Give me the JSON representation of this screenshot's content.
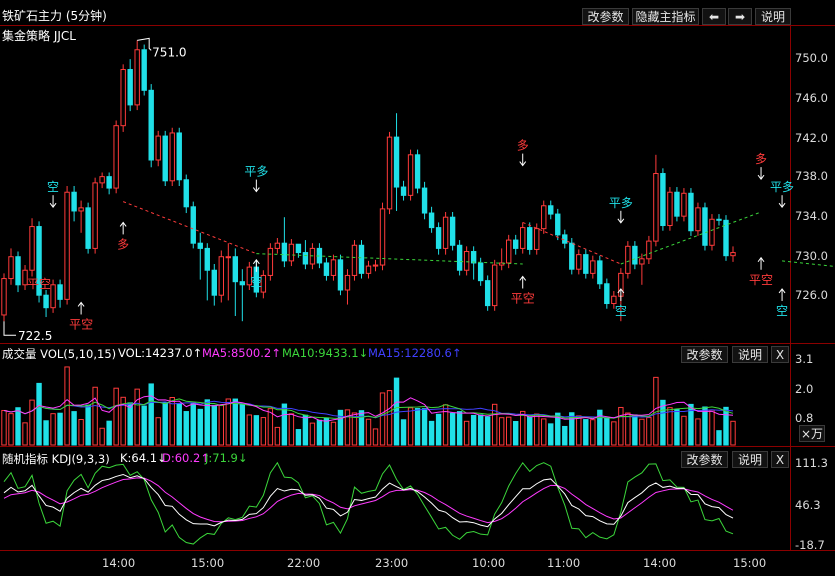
{
  "header": {
    "title": "铁矿石主力 (5分钟)",
    "strategy": "集金策略 JJCL",
    "buttons": {
      "edit_params": "改参数",
      "hide_indicators": "隐藏主指标",
      "prev": "⬅",
      "next": "➡",
      "help": "说明"
    }
  },
  "colors": {
    "up": "#ff3b3b",
    "down": "#20e0e8",
    "ma5": "#ff3bff",
    "ma10": "#3bd63b",
    "ma15": "#4040ff",
    "k": "#ffffff",
    "d": "#ff3bff",
    "j": "#3bd63b",
    "grid": "#8b0000"
  },
  "volume_panel": {
    "label": "成交量 VOL(5,10,15)",
    "vol": "VOL:14237.0↑",
    "ma5": "MA5:8500.2↑",
    "ma10": "MA10:9433.1↓",
    "ma15": "MA15:12280.6↑",
    "edit_button": "改参数",
    "help_button": "说明",
    "close_button": "X",
    "unit": "×万"
  },
  "kdj_panel": {
    "label": "随机指标 KDJ(9,3,3)",
    "k": "K:64.1↓",
    "d": "D:60.2↑",
    "j": "J:71.9↓",
    "edit_button": "改参数",
    "help_button": "说明",
    "close_button": "X"
  },
  "chart_data": [
    {
      "type": "candlestick",
      "title": "铁矿石主力 (5分钟)",
      "y_ticks": [
        "750.0",
        "746.0",
        "742.0",
        "738.0",
        "734.0",
        "730.0",
        "726.0"
      ],
      "ylim": [
        722,
        752
      ],
      "high_label": "751.0",
      "low_label": "722.5",
      "candles": [
        [
          724.6,
          728.1,
          724.0,
          728.6
        ],
        [
          728.1,
          730.2,
          727.5,
          731.0
        ],
        [
          730.2,
          727.5,
          726.8,
          730.7
        ],
        [
          727.5,
          728.9,
          727.0,
          729.4
        ],
        [
          728.9,
          733.1,
          728.3,
          733.9
        ],
        [
          733.1,
          726.5,
          725.8,
          733.6
        ],
        [
          726.5,
          725.3,
          724.4,
          727.0
        ],
        [
          725.3,
          727.5,
          724.8,
          728.0
        ],
        [
          727.5,
          726.1,
          725.3,
          728.0
        ],
        [
          726.1,
          736.4,
          725.6,
          737.0
        ],
        [
          736.4,
          734.6,
          733.6,
          737.0
        ],
        [
          734.6,
          734.9,
          732.5,
          735.6
        ],
        [
          734.9,
          731.0,
          730.5,
          735.4
        ],
        [
          731.0,
          737.3,
          730.5,
          737.8
        ],
        [
          737.3,
          737.9,
          736.8,
          738.3
        ],
        [
          737.9,
          736.8,
          736.2,
          738.3
        ],
        [
          736.8,
          742.8,
          736.3,
          743.3
        ],
        [
          742.8,
          748.2,
          742.2,
          748.7
        ],
        [
          748.2,
          744.8,
          744.2,
          749.2
        ],
        [
          744.8,
          750.1,
          744.3,
          751.0
        ],
        [
          750.1,
          746.2,
          745.7,
          750.6
        ],
        [
          746.2,
          739.5,
          738.8,
          746.8
        ],
        [
          739.5,
          741.8,
          738.9,
          742.3
        ],
        [
          741.8,
          737.5,
          737.0,
          742.3
        ],
        [
          737.5,
          742.1,
          737.0,
          742.6
        ],
        [
          742.1,
          737.6,
          737.0,
          742.6
        ],
        [
          737.6,
          735.0,
          734.4,
          738.1
        ],
        [
          735.0,
          731.5,
          731.0,
          735.5
        ],
        [
          731.5,
          731.0,
          728.0,
          732.5
        ],
        [
          731.0,
          728.9,
          726.0,
          731.5
        ],
        [
          728.9,
          726.5,
          725.5,
          729.5
        ],
        [
          726.5,
          730.2,
          725.8,
          730.8
        ],
        [
          730.2,
          730.2,
          726.0,
          731.5
        ],
        [
          730.2,
          727.8,
          724.5,
          731.0
        ],
        [
          727.8,
          727.5,
          724.0,
          729.0
        ],
        [
          727.5,
          729.2,
          727.0,
          729.7
        ],
        [
          729.2,
          726.8,
          726.3,
          729.9
        ],
        [
          726.8,
          728.4,
          726.2,
          728.9
        ],
        [
          728.4,
          731.0,
          727.9,
          731.5
        ],
        [
          731.0,
          731.5,
          730.5,
          732.0
        ],
        [
          731.5,
          729.8,
          729.2,
          734.0
        ],
        [
          729.8,
          731.4,
          729.3,
          731.9
        ],
        [
          731.4,
          730.6,
          730.1,
          731.1
        ],
        [
          730.6,
          729.5,
          729.0,
          731.8
        ],
        [
          729.5,
          731.0,
          729.0,
          731.5
        ],
        [
          731.0,
          729.6,
          729.1,
          731.5
        ],
        [
          729.6,
          728.4,
          727.9,
          730.1
        ],
        [
          728.4,
          729.9,
          727.9,
          730.4
        ],
        [
          729.9,
          727.0,
          726.5,
          730.4
        ],
        [
          727.0,
          728.4,
          725.6,
          729.0
        ],
        [
          728.4,
          731.3,
          727.9,
          731.8
        ],
        [
          731.3,
          728.6,
          728.1,
          731.8
        ],
        [
          728.6,
          729.3,
          728.1,
          729.8
        ],
        [
          729.3,
          729.4,
          728.8,
          729.9
        ],
        [
          729.4,
          734.8,
          728.9,
          735.4
        ],
        [
          734.8,
          741.7,
          734.3,
          742.2
        ],
        [
          741.7,
          736.9,
          734.6,
          744.0
        ],
        [
          736.9,
          736.1,
          735.6,
          737.5
        ],
        [
          736.1,
          740.0,
          735.6,
          740.5
        ],
        [
          740.0,
          736.8,
          736.3,
          740.5
        ],
        [
          736.8,
          734.4,
          733.8,
          737.4
        ],
        [
          734.4,
          733.0,
          732.5,
          735.0
        ],
        [
          733.0,
          731.0,
          730.4,
          733.5
        ],
        [
          731.0,
          734.0,
          730.4,
          734.5
        ],
        [
          734.0,
          731.3,
          730.8,
          734.5
        ],
        [
          731.3,
          728.9,
          728.4,
          731.8
        ],
        [
          728.9,
          730.7,
          728.4,
          731.2
        ],
        [
          730.7,
          729.6,
          728.0,
          731.2
        ],
        [
          729.6,
          727.9,
          727.4,
          730.1
        ],
        [
          727.9,
          725.5,
          725.0,
          728.4
        ],
        [
          725.5,
          729.4,
          725.0,
          729.9
        ],
        [
          729.4,
          729.6,
          728.9,
          731.0
        ],
        [
          729.6,
          731.8,
          729.1,
          732.3
        ],
        [
          731.8,
          731.0,
          730.4,
          732.3
        ],
        [
          731.0,
          733.0,
          730.5,
          733.5
        ],
        [
          733.0,
          730.9,
          730.4,
          733.5
        ],
        [
          730.9,
          732.9,
          730.4,
          733.4
        ],
        [
          732.9,
          735.1,
          732.4,
          735.6
        ],
        [
          735.1,
          734.3,
          733.8,
          735.6
        ],
        [
          734.3,
          732.3,
          731.8,
          734.8
        ],
        [
          732.3,
          731.5,
          731.0,
          732.8
        ],
        [
          731.5,
          729.0,
          728.5,
          732.0
        ],
        [
          729.0,
          730.4,
          728.5,
          730.9
        ],
        [
          730.4,
          728.6,
          728.1,
          730.9
        ],
        [
          728.6,
          729.8,
          728.1,
          730.3
        ],
        [
          729.8,
          727.6,
          727.1,
          730.3
        ],
        [
          727.6,
          725.7,
          725.2,
          728.1
        ],
        [
          725.7,
          726.4,
          725.2,
          726.9
        ],
        [
          726.4,
          728.6,
          724.0,
          729.1
        ],
        [
          728.6,
          731.2,
          728.1,
          731.7
        ],
        [
          731.2,
          729.5,
          729.0,
          731.7
        ],
        [
          729.5,
          730.0,
          727.5,
          730.5
        ],
        [
          730.0,
          731.7,
          729.5,
          732.2
        ],
        [
          731.7,
          738.2,
          731.2,
          740.0
        ],
        [
          738.2,
          733.2,
          732.7,
          738.7
        ],
        [
          733.2,
          736.4,
          732.7,
          736.9
        ],
        [
          736.4,
          734.1,
          733.6,
          736.9
        ],
        [
          734.1,
          736.3,
          733.6,
          736.8
        ],
        [
          736.3,
          732.7,
          732.2,
          736.8
        ],
        [
          732.7,
          734.9,
          732.2,
          735.4
        ],
        [
          734.9,
          731.3,
          730.8,
          735.4
        ],
        [
          731.3,
          733.8,
          730.8,
          734.3
        ],
        [
          733.8,
          733.7,
          733.2,
          734.3
        ],
        [
          733.7,
          730.3,
          729.8,
          734.2
        ],
        [
          730.3,
          730.6,
          729.7,
          731.2
        ]
      ],
      "annotations": [
        {
          "text": "空",
          "color": "down",
          "i": 7,
          "y": 736.5,
          "arrow": "down"
        },
        {
          "text": "多",
          "color": "up",
          "i": 17,
          "y": 731.0,
          "arrow": "up"
        },
        {
          "text": "平多",
          "color": "down",
          "i": 36,
          "y": 738.0,
          "arrow": "down"
        },
        {
          "text": "空",
          "color": "down",
          "i": 36,
          "y": 727.4,
          "arrow": "up"
        },
        {
          "text": "多",
          "color": "up",
          "i": 74,
          "y": 740.5,
          "arrow": "down"
        },
        {
          "text": "平多",
          "color": "down",
          "i": 88,
          "y": 735.0,
          "arrow": "down"
        },
        {
          "text": "空",
          "color": "down",
          "i": 88,
          "y": 724.6,
          "arrow": "up"
        },
        {
          "text": "平空",
          "color": "up",
          "i": 74,
          "y": 725.8,
          "arrow": "up"
        },
        {
          "text": "多",
          "color": "up",
          "i": 108,
          "y": 739.2,
          "arrow": "down"
        },
        {
          "text": "平多",
          "color": "down",
          "i": 111,
          "y": 736.5,
          "arrow": "down"
        },
        {
          "text": "平空",
          "color": "up",
          "i": 108,
          "y": 727.6,
          "arrow": "up"
        },
        {
          "text": "空",
          "color": "down",
          "i": 111,
          "y": 724.6,
          "arrow": "up"
        },
        {
          "text": "平空",
          "color": "up",
          "i": 128,
          "y": 723.3,
          "arrow": "up"
        },
        {
          "text": "多",
          "color": "up",
          "i": 128,
          "y": 729.5,
          "arrow": "left"
        },
        {
          "text": "平空",
          "color": "up",
          "i": 5,
          "y": 727.2,
          "arrow": "left"
        },
        {
          "text": "平空",
          "color": "up",
          "i": 11,
          "y": 723.3,
          "arrow": "up"
        }
      ]
    },
    {
      "type": "bar",
      "title": "成交量 VOL(5,10,15)",
      "y_ticks": [
        "3.1",
        "2.0",
        "0.8"
      ],
      "ylim": [
        0,
        3.4
      ]
    },
    {
      "type": "line",
      "title": "随机指标 KDJ(9,3,3)",
      "y_ticks": [
        "111.3",
        "46.3",
        "-18.7"
      ],
      "ylim": [
        -18.7,
        111.3
      ]
    }
  ],
  "x_ticks": [
    "14:00",
    "15:00",
    "22:00",
    "23:00",
    "10:00",
    "11:00",
    "14:00",
    "15:00"
  ]
}
